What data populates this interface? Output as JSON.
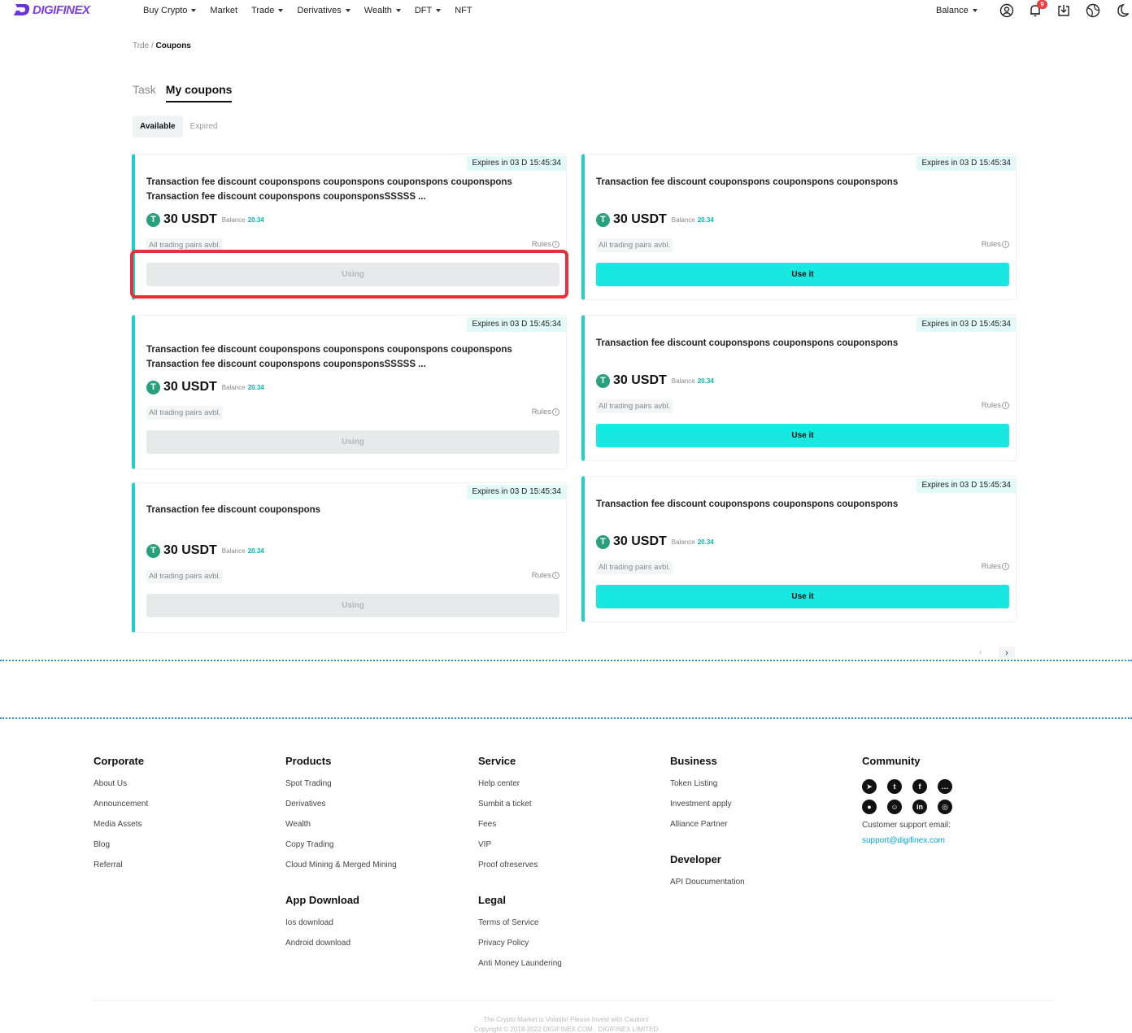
{
  "header": {
    "logo_text": "DIGIFINEX",
    "nav": [
      {
        "label": "Buy Crypto",
        "dropdown": true
      },
      {
        "label": "Market",
        "dropdown": false
      },
      {
        "label": "Trade",
        "dropdown": true
      },
      {
        "label": "Derivatives",
        "dropdown": true
      },
      {
        "label": "Wealth",
        "dropdown": true
      },
      {
        "label": "DFT",
        "dropdown": true
      },
      {
        "label": "NFT",
        "dropdown": false
      }
    ],
    "balance_label": "Balance",
    "notification_count": "9",
    "icons": [
      "user-icon",
      "bell-icon",
      "download-icon",
      "globe-icon",
      "moon-icon"
    ]
  },
  "breadcrumb": {
    "parent": "Trde",
    "separator": "/",
    "current": "Coupons"
  },
  "tabs": [
    "Task",
    "My coupons"
  ],
  "active_tab": "My coupons",
  "subtabs": [
    "Available",
    "Expired"
  ],
  "active_subtab": "Available",
  "coupons": [
    {
      "expires": "Expires in 03 D 15:45:34",
      "title": "Transaction fee discount couponspons couponspons couponspons couponspons Transaction fee discount couponspons couponsponsSSSSS ...",
      "amount": "30 USDT",
      "balance_label": "Balance",
      "balance_value": "20.34",
      "pairs": "All trading pairs avbl.",
      "rules": "Rules",
      "button": "Using",
      "state": "using"
    },
    {
      "expires": "Expires in 03 D 15:45:34",
      "title": "Transaction fee discount couponspons couponspons couponspons",
      "amount": "30 USDT",
      "balance_label": "Balance",
      "balance_value": "20.34",
      "pairs": "All trading pairs avbl.",
      "rules": "Rules",
      "button": "Use it",
      "state": "use"
    },
    {
      "expires": "Expires in 03 D 15:45:34",
      "title": "Transaction fee discount couponspons couponspons couponspons couponspons Transaction fee discount couponspons couponsponsSSSSS ...",
      "amount": "30 USDT",
      "balance_label": "Balance",
      "balance_value": "20.34",
      "pairs": "All trading pairs avbl.",
      "rules": "Rules",
      "button": "Using",
      "state": "using"
    },
    {
      "expires": "Expires in 03 D 15:45:34",
      "title": "Transaction fee discount couponspons couponspons couponspons",
      "amount": "30 USDT",
      "balance_label": "Balance",
      "balance_value": "20.34",
      "pairs": "All trading pairs avbl.",
      "rules": "Rules",
      "button": "Use it",
      "state": "use"
    },
    {
      "expires": "Expires in 03 D 15:45:34",
      "title": "Transaction fee discount couponspons",
      "amount": "30 USDT",
      "balance_label": "Balance",
      "balance_value": "20.34",
      "pairs": "All trading pairs avbl.",
      "rules": "Rules",
      "button": "Using",
      "state": "using"
    },
    {
      "expires": "Expires in 03 D 15:45:34",
      "title": "Transaction fee discount couponspons couponspons couponspons",
      "amount": "30 USDT",
      "balance_label": "Balance",
      "balance_value": "20.34",
      "pairs": "All trading pairs avbl.",
      "rules": "Rules",
      "button": "Use it",
      "state": "use"
    }
  ],
  "pagination": {
    "prev": "‹",
    "next": "›"
  },
  "colors": {
    "accent": "#17e8e2",
    "card_border": "#1ad3c9",
    "highlight": "#e4323c",
    "link": "#00b8ad"
  },
  "footer": {
    "corporate": {
      "title": "Corporate",
      "links": [
        "About Us",
        "Announcement",
        "Media Assets",
        "Blog",
        "Referral"
      ]
    },
    "products": {
      "title": "Products",
      "links": [
        "Spot Trading",
        "Derivatives",
        "Wealth",
        "Copy Trading",
        "Cloud Mining & Merged Mining"
      ]
    },
    "app_download": {
      "title": "App Download",
      "links": [
        "Ios download",
        "Android download"
      ]
    },
    "service": {
      "title": "Service",
      "links": [
        "Help center",
        "Sumbit a ticket",
        "Fees",
        "VIP",
        "Proof ofreserves"
      ]
    },
    "legal": {
      "title": "Legal",
      "links": [
        "Terms of Service",
        "Privacy Policy",
        "Anti Money Laundering"
      ]
    },
    "business": {
      "title": "Business",
      "links": [
        "Token Listing",
        "Investment apply",
        "Alliance Partner"
      ]
    },
    "developer": {
      "title": "Developer",
      "links": [
        "API Doucumentation"
      ]
    },
    "community": {
      "title": "Community",
      "socials": [
        "telegram-icon",
        "twitter-icon",
        "facebook-icon",
        "chat-icon",
        "medium-icon",
        "reddit-icon",
        "linkedin-icon",
        "instagram-icon"
      ],
      "support_label": "Customer support email:",
      "support_email": "support@digifinex.com"
    },
    "disclaimer": "The Crypto Market is Volatile! Please Invest with Caution!",
    "copyright": "Copyright © 2018-2022 DIGIFINEX.COM . DIGIFINEX LIMITED"
  }
}
